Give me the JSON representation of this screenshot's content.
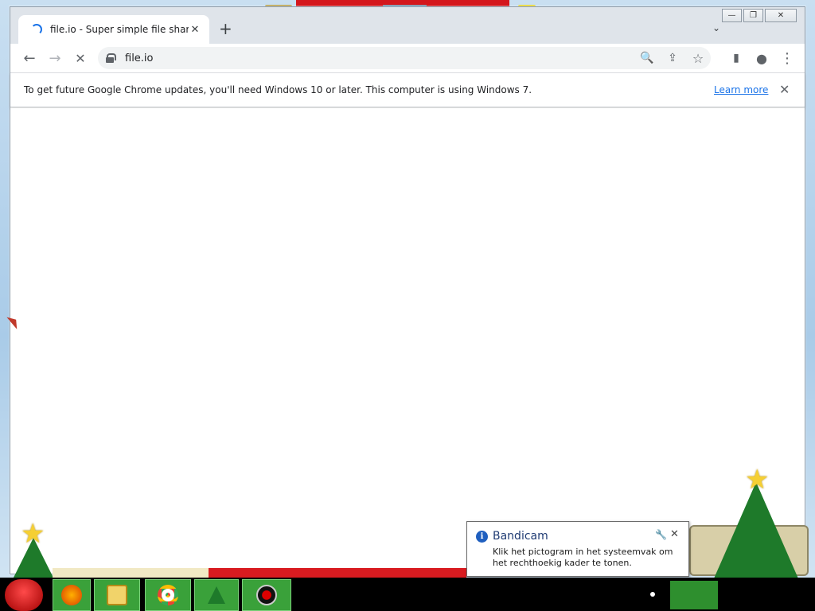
{
  "window_controls": {
    "minimize": "—",
    "restore": "❐",
    "close": "✕"
  },
  "tab": {
    "title": "file.io - Super simple file sharing",
    "close": "✕"
  },
  "new_tab": "+",
  "tab_list": "⌄",
  "toolbar": {
    "back": "←",
    "forward": "→",
    "stop": "✕",
    "url": "file.io",
    "zoom_icon": "🔍",
    "share_icon": "⇪",
    "bookmark_icon": "☆",
    "sidepanel_icon": "▮",
    "profile_icon": "●",
    "menu_icon": "⋮"
  },
  "infobar": {
    "message": "To get future Google Chrome updates, you'll need Windows 10 or later. This computer is using Windows 7.",
    "learn_more": "Learn more",
    "close": "✕"
  },
  "notification": {
    "title": "Bandicam",
    "body": "Klik het pictogram in het systeemvak om het rechthoekig kader te tonen.",
    "info_glyph": "i",
    "wrench": "🔧",
    "close": "✕"
  },
  "tree_star": "★",
  "colors": {
    "accent": "#1a73e8",
    "tree": "#1e7a2a",
    "desktop_red": "#d4161c",
    "taskbar_green": "#3aa13a"
  }
}
